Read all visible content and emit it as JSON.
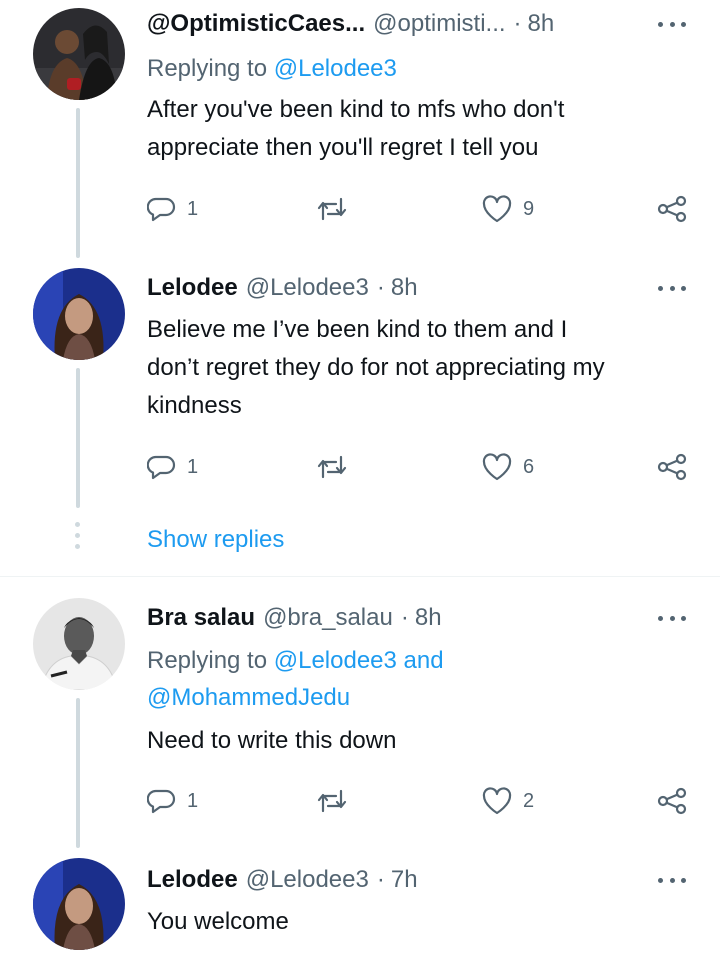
{
  "tweets": [
    {
      "name": "@OptimisticCaes...",
      "handle": "@optimisti...",
      "separator": "·",
      "time": "8h",
      "replying_label": "Replying to",
      "replying_mentions": "@Lelodee3",
      "text_lines": [
        "After you've been kind to mfs who don't",
        "appreciate then you'll regret I tell you"
      ],
      "replies": "1",
      "retweets": "",
      "likes": "9",
      "avatar_icon": "avatar-couple-dark"
    },
    {
      "name": "Lelodee",
      "handle": "@Lelodee3",
      "separator": "·",
      "time": "8h",
      "text_lines": [
        "Believe me I’ve been kind to them and I",
        "don’t regret they do for not appreciating my",
        "kindness"
      ],
      "replies": "1",
      "retweets": "",
      "likes": "6",
      "avatar_icon": "avatar-woman-blue"
    },
    {
      "name": "Bra salau",
      "handle": "@bra_salau",
      "separator": "·",
      "time": "8h",
      "replying_label": "Replying to",
      "replying_mentions_line1": "@Lelodee3 and",
      "replying_mentions_line2": "@MohammedJedu",
      "text_lines": [
        "Need to write this down"
      ],
      "replies": "1",
      "retweets": "",
      "likes": "2",
      "avatar_icon": "avatar-man-grayscale"
    },
    {
      "name": "Lelodee",
      "handle": "@Lelodee3",
      "separator": "·",
      "time": "7h",
      "text_lines": [
        "You welcome"
      ],
      "avatar_icon": "avatar-woman-blue"
    }
  ],
  "show_replies_label": "Show replies",
  "colors": {
    "accent": "#1d9bf0",
    "secondary_text": "#536471",
    "thread_line": "#cfd9de",
    "divider": "#eff3f4"
  },
  "icons": {
    "reply": "reply-bubble-icon",
    "retweet": "retweet-icon",
    "like": "heart-icon",
    "share": "share-icon",
    "more": "more-options-icon"
  }
}
